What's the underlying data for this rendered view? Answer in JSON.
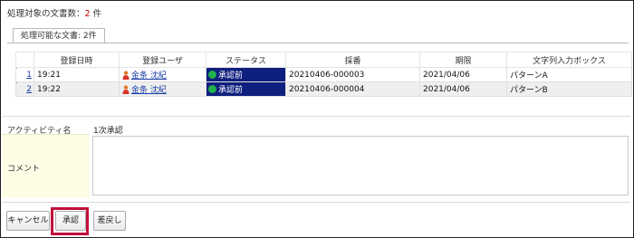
{
  "header": {
    "count_label": "処理対象の文書数：",
    "count_value": "2",
    "count_unit": "件"
  },
  "tab": {
    "label": "処理可能な文書: 2件"
  },
  "table": {
    "columns": [
      "",
      "登録日時",
      "登録ユーザ",
      "ステータス",
      "採番",
      "期限",
      "文字列入力ボックス"
    ],
    "rows": [
      {
        "no": "1",
        "date": "19:21",
        "user": "金条 沈紀",
        "status": "承認前",
        "number": "20210406-000003",
        "deadline": "2021/04/06",
        "text": "パターンA"
      },
      {
        "no": "2",
        "date": "19:22",
        "user": "金条 沈紀",
        "status": "承認前",
        "number": "20210406-000004",
        "deadline": "2021/04/06",
        "text": "パターンB"
      }
    ]
  },
  "form": {
    "activity_label": "アクティビティ名",
    "activity_value": "1次承認",
    "comment_label": "コメント",
    "comment_value": ""
  },
  "buttons": {
    "cancel": "キャンセル",
    "approve": "承認",
    "return": "差戻し"
  },
  "colors": {
    "status_bg": "#0f1f7e",
    "status_dot": "#21b04b",
    "highlight": "#c0103a",
    "count_value": "#c00000"
  },
  "icons": {
    "user": "person-icon",
    "status": "status-dot-icon",
    "row_flag": "flag-icon"
  }
}
